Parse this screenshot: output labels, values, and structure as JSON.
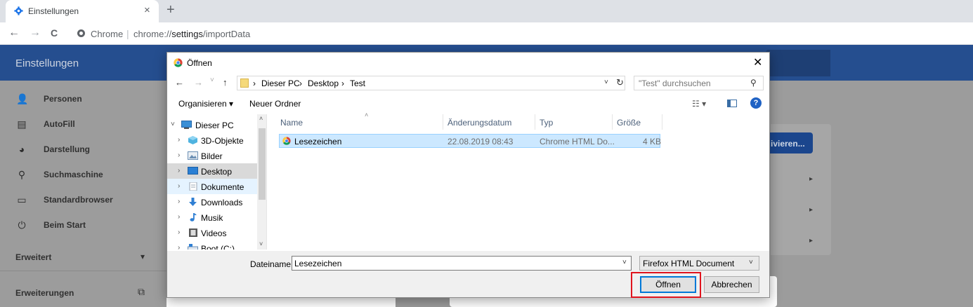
{
  "browser": {
    "tab": {
      "title": "Einstellungen",
      "icon": "gear-icon",
      "close": "×"
    },
    "new_tab": "+",
    "nav": {
      "back": "←",
      "forward": "→",
      "reload": "C"
    },
    "omnibox": {
      "site_label": "Chrome",
      "separator": "|",
      "url_prefix": "chrome://",
      "url_bold": "settings",
      "url_suffix": "/importData"
    }
  },
  "settings": {
    "title": "Einstellungen",
    "sidebar": [
      {
        "icon": "person-icon",
        "glyph": "👤",
        "label": "Personen"
      },
      {
        "icon": "clipboard-icon",
        "glyph": "▤",
        "label": "AutoFill"
      },
      {
        "icon": "palette-icon",
        "glyph": "◕",
        "label": "Darstellung"
      },
      {
        "icon": "search-icon",
        "glyph": "⚲",
        "label": "Suchmaschine"
      },
      {
        "icon": "browser-window-icon",
        "glyph": "▭",
        "label": "Standardbrowser"
      },
      {
        "icon": "power-icon",
        "glyph": "⏻",
        "label": "Beim Start"
      }
    ],
    "advanced": {
      "label": "Erweitert",
      "caret": "▾"
    },
    "extensions": {
      "label": "Erweiterungen",
      "icon": "open-external-icon",
      "glyph": "⧉"
    },
    "card_button_label": "ivieren...",
    "card_arrow": "▸"
  },
  "dialog": {
    "title": "Öffnen",
    "close": "✕",
    "address": {
      "back": "←",
      "forward": "→",
      "recent": "˅",
      "up": "↑",
      "breadcrumbs": [
        "Dieser PC",
        "Desktop",
        "Test"
      ],
      "crumb_sep": "›",
      "caret": "˅",
      "refresh": "↻"
    },
    "search": {
      "placeholder": "\"Test\" durchsuchen",
      "icon": "⚲"
    },
    "commands": {
      "organize": "Organisieren ▾",
      "new_folder": "Neuer Ordner",
      "view": "☷ ▾",
      "help": "?"
    },
    "tree": [
      {
        "label": "Dieser PC",
        "chevron": "˅",
        "icon": "computer-icon",
        "color": "#3a8fd6"
      },
      {
        "label": "3D-Objekte",
        "chevron": "›",
        "icon": "3d-objects-icon",
        "color": "#4fb3e0"
      },
      {
        "label": "Bilder",
        "chevron": "›",
        "icon": "pictures-icon",
        "color": "#6b8fb4"
      },
      {
        "label": "Desktop",
        "chevron": "›",
        "icon": "desktop-icon",
        "color": "#2a7fd4"
      },
      {
        "label": "Dokumente",
        "chevron": "›",
        "icon": "documents-icon",
        "color": "#9aa6b3"
      },
      {
        "label": "Downloads",
        "chevron": "›",
        "icon": "downloads-icon",
        "color": "#2f7fd3"
      },
      {
        "label": "Musik",
        "chevron": "›",
        "icon": "music-icon",
        "color": "#2f7fd3"
      },
      {
        "label": "Videos",
        "chevron": "›",
        "icon": "videos-icon",
        "color": "#555555"
      },
      {
        "label": "Boot (C:)",
        "chevron": "›",
        "icon": "drive-icon",
        "color": "#6b8fb4"
      }
    ],
    "scroll": {
      "up": "˄",
      "down": "˅"
    },
    "columns": [
      "Name",
      "Änderungsdatum",
      "Typ",
      "Größe"
    ],
    "sort_indicator": "˄",
    "files": [
      {
        "name": "Lesezeichen",
        "modified": "22.08.2019 08:43",
        "type": "Chrome HTML Do...",
        "size": "4 KB"
      }
    ],
    "filename": {
      "label": "Dateiname:",
      "value": "Lesezeichen",
      "caret": "˅"
    },
    "filetype": {
      "value": "Firefox HTML Document",
      "caret": "˅"
    },
    "buttons": {
      "open": "Öffnen",
      "cancel": "Abbrechen"
    },
    "highlight_color": "#e0141e"
  }
}
